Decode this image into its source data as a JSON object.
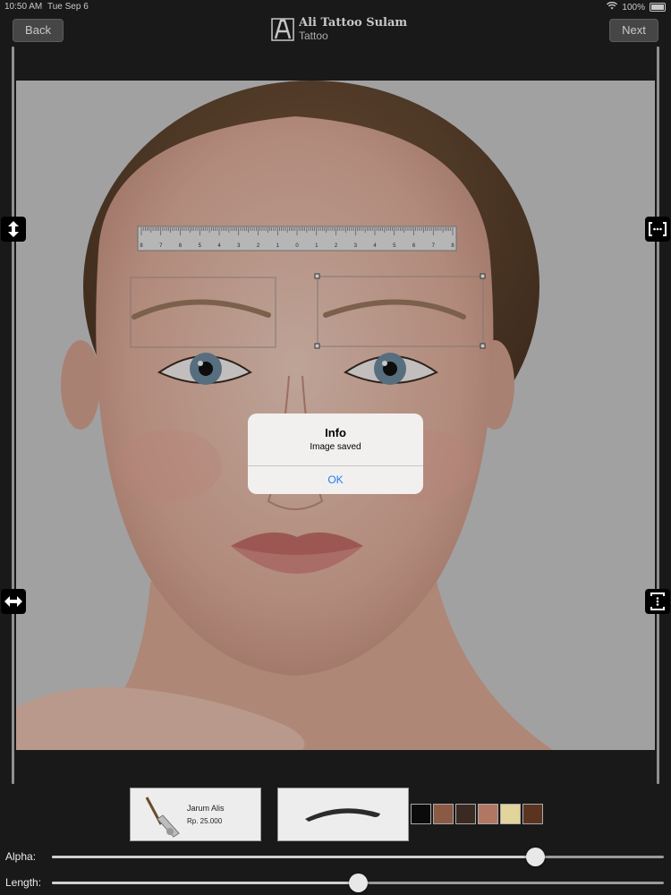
{
  "status": {
    "time": "10:50 AM",
    "date": "Tue Sep 6",
    "battery": "100%"
  },
  "header": {
    "back_label": "Back",
    "next_label": "Next",
    "app_name": "Ali Tattoo Sulam",
    "subtitle": "Tattoo"
  },
  "ruler": {
    "ticks": [
      "8",
      "7",
      "6",
      "5",
      "4",
      "3",
      "2",
      "1",
      "0",
      "1",
      "2",
      "3",
      "4",
      "5",
      "6",
      "7",
      "8"
    ]
  },
  "side_controls": {
    "left_top": "vertical-resize-icon",
    "left_bottom": "horizontal-resize-icon",
    "right_top": "expand-horizontal-icon",
    "right_bottom": "expand-vertical-icon"
  },
  "dialog": {
    "title": "Info",
    "message": "Image saved",
    "ok_label": "OK"
  },
  "product": {
    "name": "Jarum Alis",
    "price": "Rp. 25.000"
  },
  "swatches": [
    "#0b0b0b",
    "#8a5a44",
    "#3a2a21",
    "#b27763",
    "#e2d49a",
    "#5a3420"
  ],
  "sliders": [
    {
      "label": "Alpha:",
      "value": 0.79
    },
    {
      "label": "Length:",
      "value": 0.5
    }
  ]
}
